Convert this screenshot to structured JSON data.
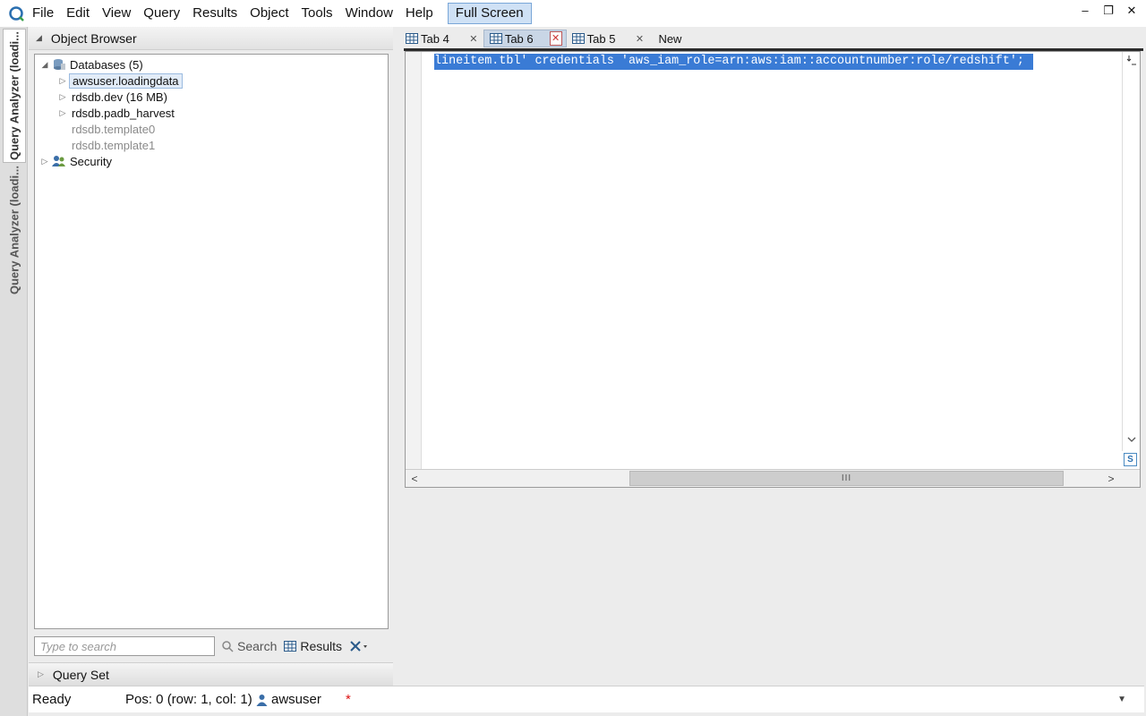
{
  "menu": {
    "items": [
      "File",
      "Edit",
      "View",
      "Query",
      "Results",
      "Object",
      "Tools",
      "Window",
      "Help"
    ],
    "fullscreen_label": "Full Screen"
  },
  "window_controls": {
    "minimize": "–",
    "restore": "❐",
    "close": "✕"
  },
  "side_tabs": [
    "Query Analyzer (loadi...",
    "Query Analyzer (loadi..."
  ],
  "object_browser": {
    "title": "Object Browser",
    "tree": {
      "databases_label": "Databases (5)",
      "db_items": [
        {
          "label": "awsuser.loadingdata",
          "selected": true,
          "expandable": true
        },
        {
          "label": "rdsdb.dev (16 MB)",
          "expandable": true
        },
        {
          "label": "rdsdb.padb_harvest",
          "expandable": true
        },
        {
          "label": "rdsdb.template0",
          "expandable": false
        },
        {
          "label": "rdsdb.template1",
          "expandable": false
        }
      ],
      "security_label": "Security"
    },
    "search": {
      "placeholder": "Type to search",
      "search_label": "Search",
      "results_label": "Results"
    }
  },
  "query_set": {
    "label": "Query Set"
  },
  "tabs": [
    {
      "label": "Tab 4",
      "active": false
    },
    {
      "label": "Tab 6",
      "active": true
    },
    {
      "label": "Tab 5",
      "active": false
    }
  ],
  "new_tab_label": "New",
  "editor": {
    "code": "lineitem.tbl' credentials 'aws_iam_role=arn:aws:iam::accountnumber:role/redshift';",
    "hscroll_thumb": "III"
  },
  "status": {
    "state": "Ready",
    "position": "Pos: 0 (row: 1, col: 1)",
    "user": "awsuser",
    "modified": "*"
  },
  "colors": {
    "selection": "#3a7bd5",
    "accent": "#7aa7d8"
  }
}
